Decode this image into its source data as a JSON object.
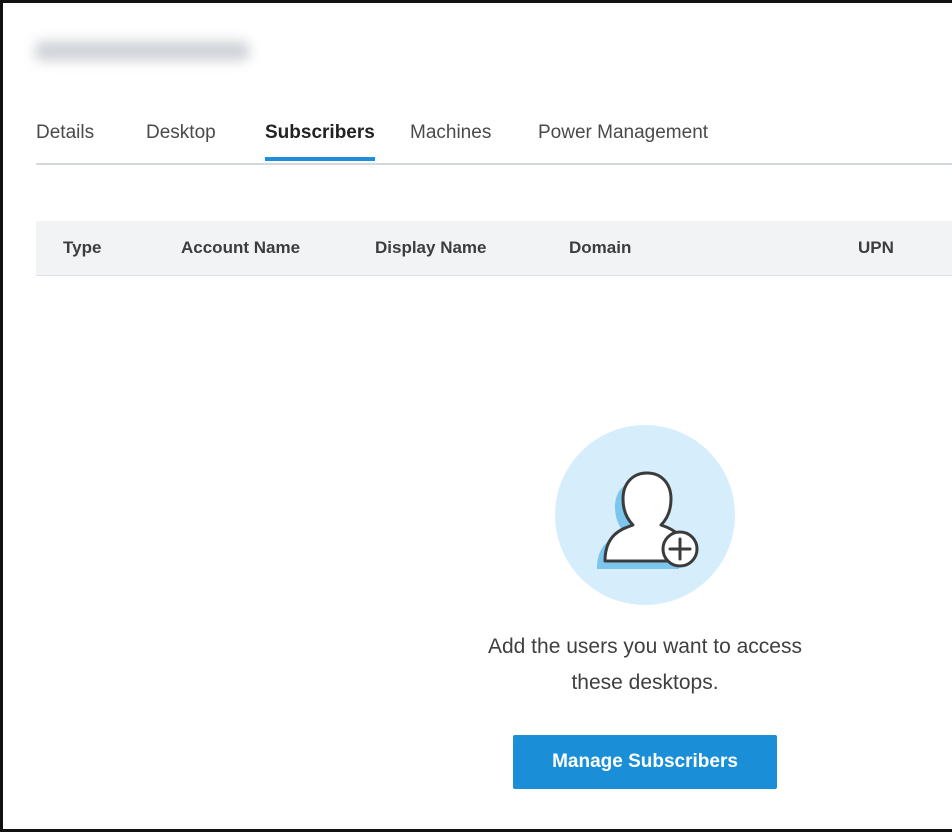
{
  "tabs": [
    {
      "label": "Details",
      "active": false
    },
    {
      "label": "Desktop",
      "active": false
    },
    {
      "label": "Subscribers",
      "active": true
    },
    {
      "label": "Machines",
      "active": false
    },
    {
      "label": "Power Management",
      "active": false
    }
  ],
  "table": {
    "columns": [
      "Type",
      "Account Name",
      "Display Name",
      "Domain",
      "UPN"
    ]
  },
  "empty_state": {
    "icon": "add-user-icon",
    "message_line1": "Add the users you want to access",
    "message_line2": "these desktops.",
    "button_label": "Manage Subscribers"
  },
  "colors": {
    "accent": "#1a8fd8",
    "tab_underline": "#1e8ed8",
    "illustration_circle": "#d6eefb",
    "illustration_shadow": "#7cc6ee"
  }
}
